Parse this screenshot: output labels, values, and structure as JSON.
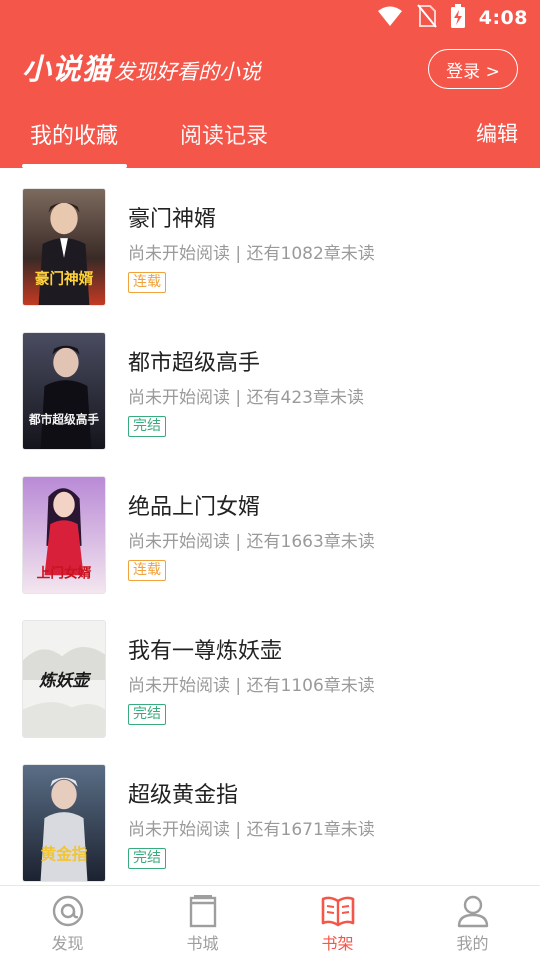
{
  "status_bar": {
    "time": "4:08"
  },
  "header": {
    "brand_name": "小说猫",
    "brand_slogan": "发现好看的小说",
    "login_label": "登录 >",
    "tabs": [
      {
        "label": "我的收藏",
        "active": true
      },
      {
        "label": "阅读记录",
        "active": false
      }
    ],
    "edit_label": "编辑"
  },
  "books": [
    {
      "title": "豪门神婿",
      "progress": "尚未开始阅读 | 还有1082章未读",
      "status": "连载",
      "cover_text": "豪门神婿"
    },
    {
      "title": "都市超级高手",
      "progress": "尚未开始阅读 | 还有423章未读",
      "status": "完结",
      "cover_text": "都市超级高手"
    },
    {
      "title": "绝品上门女婿",
      "progress": "尚未开始阅读 | 还有1663章未读",
      "status": "连载",
      "cover_text": "上门女婿"
    },
    {
      "title": "我有一尊炼妖壶",
      "progress": "尚未开始阅读 | 还有1106章未读",
      "status": "完结",
      "cover_text": "炼妖壶"
    },
    {
      "title": "超级黄金指",
      "progress": "尚未开始阅读 | 还有1671章未读",
      "status": "完结",
      "cover_text": "黄金指"
    }
  ],
  "bottom_nav": [
    {
      "label": "发现",
      "icon": "at-icon",
      "active": false
    },
    {
      "label": "书城",
      "icon": "book-closed-icon",
      "active": false
    },
    {
      "label": "书架",
      "icon": "book-open-icon",
      "active": true
    },
    {
      "label": "我的",
      "icon": "person-icon",
      "active": false
    }
  ],
  "colors": {
    "accent": "#f5564a",
    "ongoing": "#f0a23c",
    "completed": "#3aab7d"
  }
}
